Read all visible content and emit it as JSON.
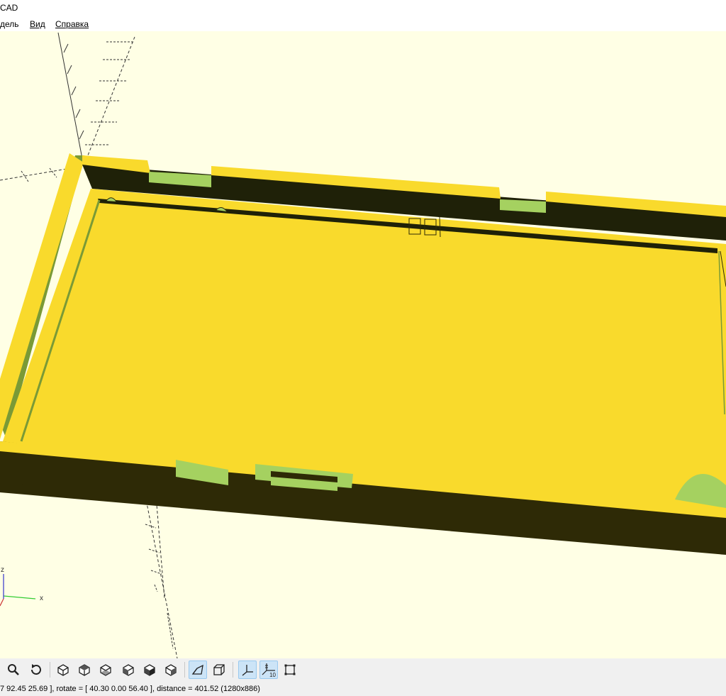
{
  "window": {
    "title": "CAD"
  },
  "menu": {
    "items": [
      {
        "label": "дель",
        "underline": ""
      },
      {
        "label": "Вид",
        "underline": "В"
      },
      {
        "label": "Справка",
        "underline": "С"
      }
    ]
  },
  "viewport": {
    "background": "#ffffe5",
    "colors": {
      "face_top": "#f9da2c",
      "face_front": "#2e2a06",
      "face_back_wall": "#1f2108",
      "cut_surface": "#a5d160",
      "wall_side": "#7a9a36"
    },
    "axis_labels": {
      "x": "x",
      "z": "z"
    }
  },
  "toolbar": {
    "buttons": [
      {
        "name": "zoom-in-button",
        "icon": "magnifier-icon"
      },
      {
        "name": "reset-view-button",
        "icon": "reset-view-icon"
      },
      {
        "name": "view-right-button",
        "icon": "view-right-icon"
      },
      {
        "name": "view-top-button",
        "icon": "view-top-icon"
      },
      {
        "name": "view-bottom-button",
        "icon": "view-bottom-icon"
      },
      {
        "name": "view-left-button",
        "icon": "view-left-icon"
      },
      {
        "name": "view-front-button",
        "icon": "view-front-icon"
      },
      {
        "name": "view-back-button",
        "icon": "view-back-icon"
      },
      {
        "name": "perspective-button",
        "icon": "perspective-icon",
        "active": true
      },
      {
        "name": "orthogonal-button",
        "icon": "orthogonal-icon",
        "active": false
      },
      {
        "name": "show-axes-button",
        "icon": "axes-icon",
        "active": true
      },
      {
        "name": "show-scale-markers-button",
        "icon": "scale-markers-icon",
        "active": true,
        "text": "10"
      },
      {
        "name": "show-edges-button",
        "icon": "edges-icon",
        "active": false
      }
    ]
  },
  "status": {
    "text": "7 92.45 25.69 ], rotate = [ 40.30 0.00 56.40 ], distance = 401.52 (1280x886)"
  }
}
